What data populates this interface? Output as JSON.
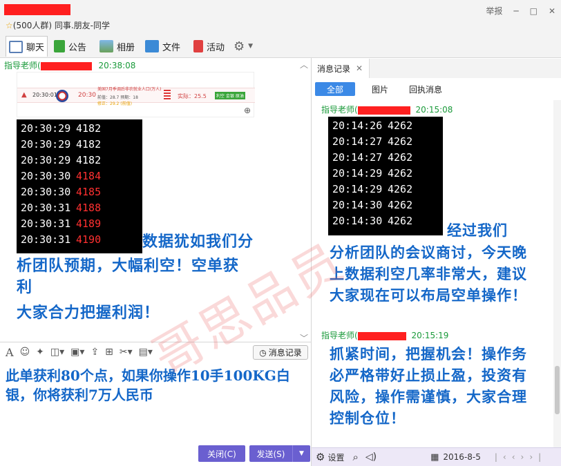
{
  "window": {
    "group_info": "(500人群) 同事.朋友-同学",
    "report": "举报",
    "minimize": "─",
    "maximize": "□",
    "close": "✕"
  },
  "toolbar": {
    "chat": "聊天",
    "notice": "公告",
    "album": "相册",
    "file": "文件",
    "activity": "活动"
  },
  "chat": {
    "sender": "指导老师(",
    "time": "20:38:08",
    "card": {
      "time": "20:30:01",
      "time2": "20:30",
      "title": "美国7月季调后非农就业人口(万人)",
      "prev": "前值：28.7 预期：18",
      "after": "修正：29.2 (前值)",
      "actual": "实际：25.5",
      "tag": "利空 金银 原油"
    },
    "ticks": [
      {
        "t": "20:30:29",
        "v": "4182",
        "red": false
      },
      {
        "t": "20:30:29",
        "v": "4182",
        "red": false
      },
      {
        "t": "20:30:29",
        "v": "4182",
        "red": false
      },
      {
        "t": "20:30:30",
        "v": "4184",
        "red": true
      },
      {
        "t": "20:30:30",
        "v": "4185",
        "red": true
      },
      {
        "t": "20:30:31",
        "v": "4188",
        "red": true
      },
      {
        "t": "20:30:31",
        "v": "4189",
        "red": true
      },
      {
        "t": "20:30:31",
        "v": "4190",
        "red": true
      }
    ],
    "msg_tail": "数据犹如我们分",
    "msg_line2": "析团队预期，大幅利空！空单获",
    "msg_line3": "利",
    "msg_line4": "大家合力把握利润！"
  },
  "input": {
    "msg_log_button": "消息记录",
    "text": "此单获利80个点，如果你操作10手100KG白银，你将获利7万人民币",
    "close_button": "关闭(C)",
    "send_button": "发送(S)"
  },
  "history": {
    "tab": "消息记录",
    "filters": {
      "all": "全部",
      "image": "图片",
      "receipt": "回执消息"
    },
    "sender1": "指导老师(",
    "time1": "20:15:08",
    "ticks": [
      {
        "t": "20:14:26",
        "v": "4262"
      },
      {
        "t": "20:14:27",
        "v": "4262"
      },
      {
        "t": "20:14:27",
        "v": "4262"
      },
      {
        "t": "20:14:29",
        "v": "4262"
      },
      {
        "t": "20:14:29",
        "v": "4262"
      },
      {
        "t": "20:14:30",
        "v": "4262"
      },
      {
        "t": "20:14:30",
        "v": "4262"
      }
    ],
    "msg1_tail": "经过我们",
    "msg1_rest": "分析团队的会议商讨，今天晚上数据利空几率非常大，建议大家现在可以布局空单操作！",
    "sender2": "指导老师(",
    "time2": "20:15:19",
    "msg2": "抓紧时间，把握机会！操作务必严格带好止损止盈，投资有风险，操作需谨慎，大家合理控制仓位！"
  },
  "bottombar": {
    "settings": "设置",
    "date": "2016-8-5"
  },
  "watermark": "哥思品员"
}
